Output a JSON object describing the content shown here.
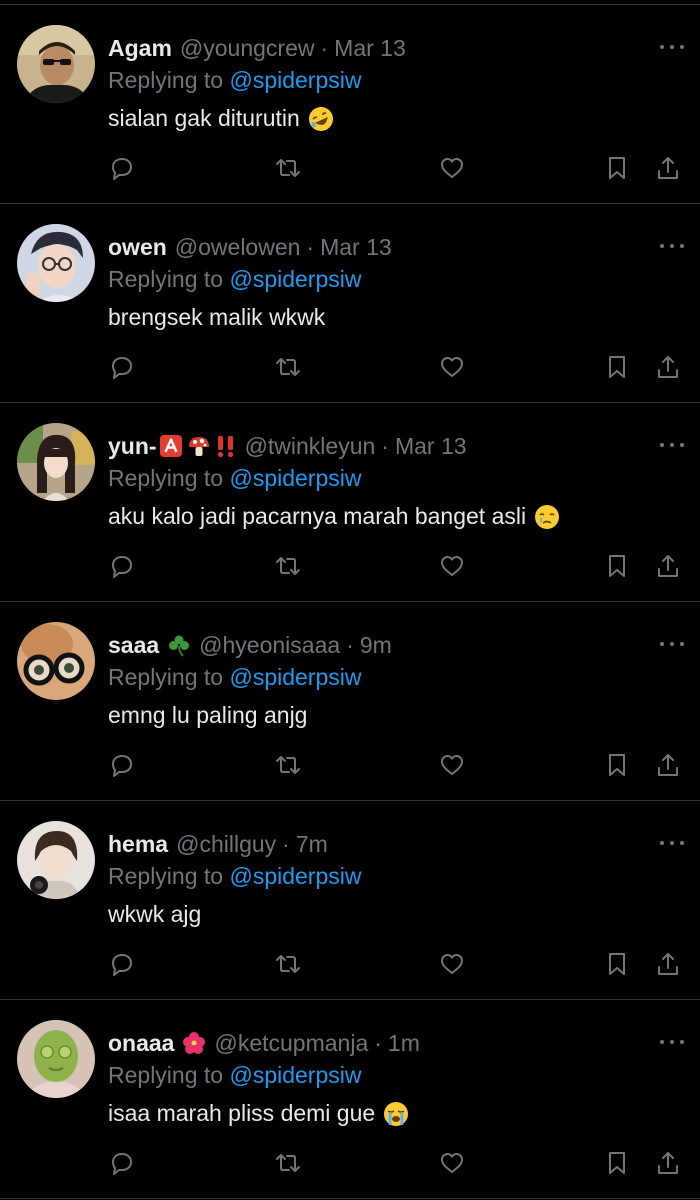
{
  "replies": [
    {
      "display_name": "Agam",
      "name_emojis": [],
      "handle": "@youngcrew",
      "separator": "·",
      "time": "Mar 13",
      "replying_prefix": "Replying to",
      "replying_to": "@spiderpsiw",
      "text": "sialan gak diturutin",
      "text_emoji": "rolling-on-floor-laughing",
      "avatar_icon": "avatar-photo-sunglasses"
    },
    {
      "display_name": "owen",
      "name_emojis": [],
      "handle": "@owelowen",
      "separator": "·",
      "time": "Mar 13",
      "replying_prefix": "Replying to",
      "replying_to": "@spiderpsiw",
      "text": "brengsek malik wkwk",
      "text_emoji": "",
      "avatar_icon": "avatar-photo-glasses-hand"
    },
    {
      "display_name": "yun-",
      "name_emojis": [
        "a-button",
        "mushroom",
        "double-exclamation"
      ],
      "handle": "@twinkleyun",
      "separator": "·",
      "time": "Mar 13",
      "replying_prefix": "Replying to",
      "replying_to": "@spiderpsiw",
      "text": "aku kalo jadi pacarnya marah banget asli",
      "text_emoji": "face-holding-back-tears",
      "avatar_icon": "avatar-photo-girl"
    },
    {
      "display_name": "saaa",
      "name_emojis": [
        "shamrock"
      ],
      "handle": "@hyeonisaaa",
      "separator": "·",
      "time": "9m",
      "replying_prefix": "Replying to",
      "replying_to": "@spiderpsiw",
      "text": "emng lu paling anjg",
      "text_emoji": "",
      "avatar_icon": "avatar-photo-glasses-closeup"
    },
    {
      "display_name": "hema",
      "name_emojis": [],
      "handle": "@chillguy",
      "separator": "·",
      "time": "7m",
      "replying_prefix": "Replying to",
      "replying_to": "@spiderpsiw",
      "text": "wkwk ajg",
      "text_emoji": "",
      "avatar_icon": "avatar-photo-headphones"
    },
    {
      "display_name": "onaaa",
      "name_emojis": [
        "hibiscus"
      ],
      "handle": "@ketcupmanja",
      "separator": "·",
      "time": "1m",
      "replying_prefix": "Replying to",
      "replying_to": "@spiderpsiw",
      "text": "isaa marah pliss demi gue",
      "text_emoji": "loudly-crying-face",
      "avatar_icon": "avatar-photo-face-mask"
    }
  ],
  "colors": {
    "background": "#000000",
    "primary_text": "#e7e9ea",
    "secondary_text": "#71767b",
    "link": "#1d9bf0",
    "divider": "#2f3336"
  },
  "action_icons": [
    "reply-icon",
    "retweet-icon",
    "like-icon",
    "bookmark-icon",
    "share-icon"
  ]
}
